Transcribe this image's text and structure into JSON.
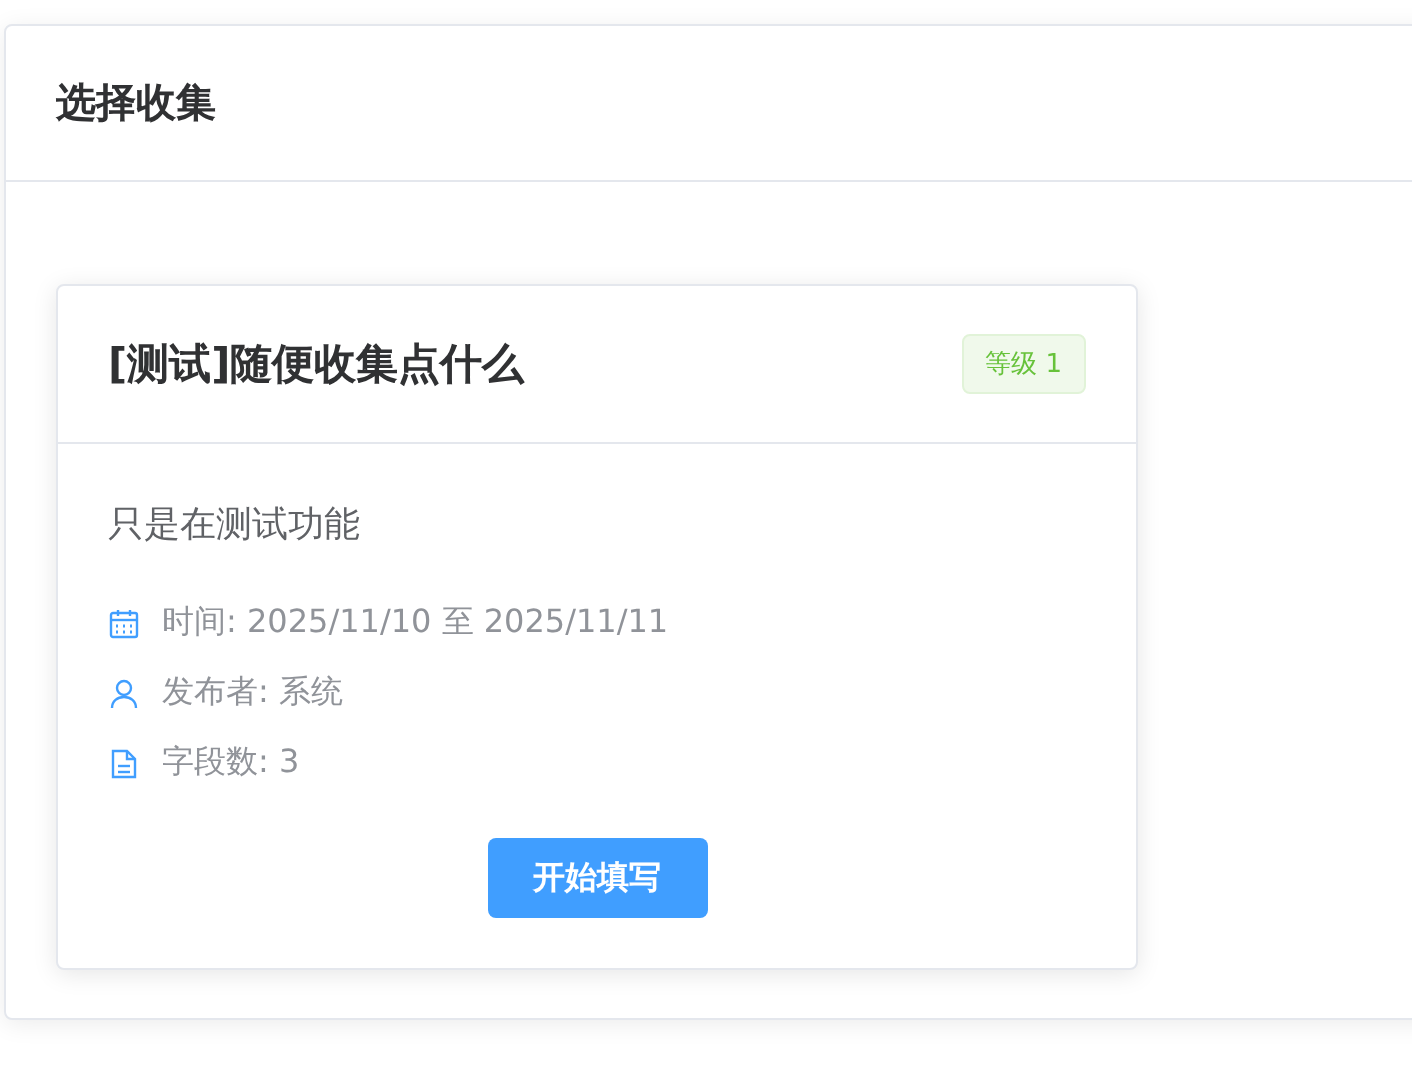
{
  "panel": {
    "title": "选择收集"
  },
  "cards": [
    {
      "title": "[测试]随便收集点什么",
      "badge": "等级 1",
      "description": "只是在测试功能",
      "meta": [
        {
          "kind": "calendar",
          "text": "时间: 2025/11/10 至 2025/11/11"
        },
        {
          "kind": "user",
          "text": "发布者: 系统"
        },
        {
          "kind": "document",
          "text": "字段数: 3"
        }
      ],
      "button": "开始填写"
    }
  ]
}
